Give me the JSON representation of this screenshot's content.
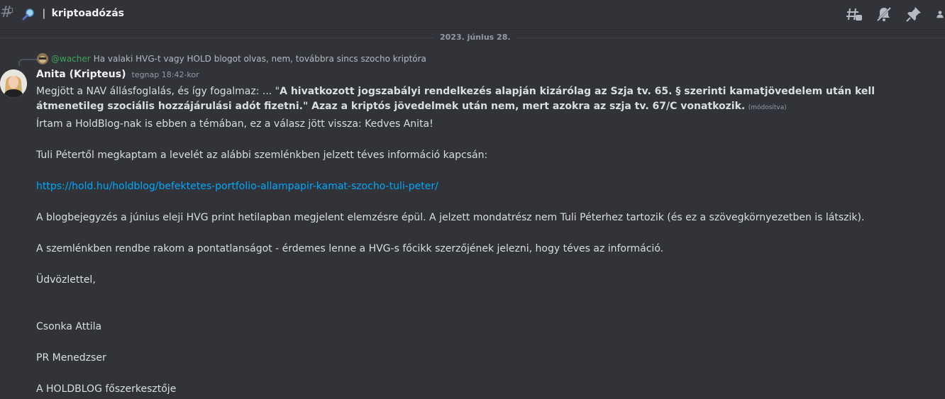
{
  "header": {
    "channel_name": "kriptoadózás",
    "icons": [
      "hash-lock-icon",
      "magnify-icon",
      "threads-icon",
      "mute-icon",
      "pin-icon",
      "member-list-icon"
    ]
  },
  "date_divider": "2023. június 28.",
  "reply": {
    "user": "@wacher",
    "text": "Ha valaki HVG-t vagy HOLD blogot olvas, nem, továbbra sincs szocho kriptóra"
  },
  "message": {
    "author": "Anita (Kripteus)",
    "timestamp": "tegnap 18:42-kor",
    "first_text": "Megjött a NAV állásfoglalás, és így fogalmaz: ... \"",
    "bold_quote": "A hivatkozott jogszabályi rendelkezés alapján kizárólag az Szja tv. 65. § szerinti kamatjövedelem után kell átmenetileg szociális hozzájárulási adót fizetni.\" Azaz a kriptós jövedelmek után nem, mert azokra az szja tv. 67/C vonatkozik.",
    "edited": "(módosítva)",
    "lines": [
      "Írtam a HoldBlog-nak is ebben a témában, ez a válasz jött vissza: Kedves Anita!",
      "Tuli Pétertől megkaptam a levelét az alábbi szemlénkben jelzett téves információ kapcsán:",
      "https://hold.hu/holdblog/befektetes-portfolio-allampapir-kamat-szocho-tuli-peter/",
      "A blogbejegyzés a június eleji HVG print hetilapban megjelent elemzésre épül. A jelzett mondatrész nem Tuli Péterhez tartozik (és ez a szövegkörnyezetben is látszik).",
      "A szemlénkben rendbe rakom a pontatlanságot - érdemes lenne a HVG-s főcikk szerzőjének jelezni, hogy téves az információ.",
      "Üdvözlettel,",
      "Csonka Attila",
      "PR Menedzser",
      "A HOLDBLOG főszerkesztője"
    ]
  },
  "colors": {
    "background": "#313338",
    "link": "#00a8fc",
    "reply_user": "#3ba55d"
  }
}
